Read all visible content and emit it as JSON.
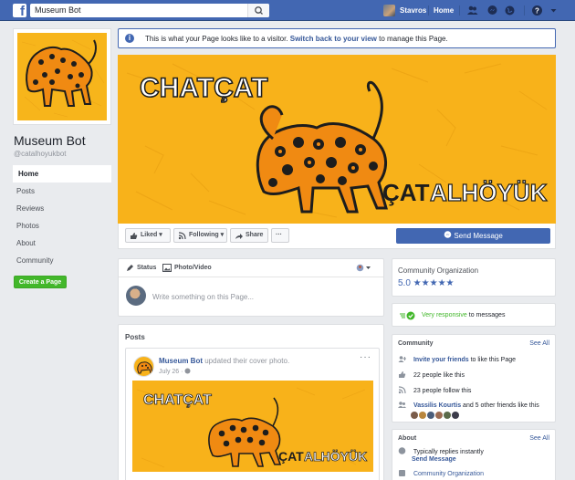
{
  "topbar": {
    "logo": "f",
    "search_value": "Museum Bot",
    "user_name": "Stavros",
    "home_label": "Home"
  },
  "page": {
    "name": "Museum Bot",
    "handle": "@catalhoyukbot"
  },
  "leftnav": {
    "items": [
      {
        "label": "Home"
      },
      {
        "label": "Posts"
      },
      {
        "label": "Reviews"
      },
      {
        "label": "Photos"
      },
      {
        "label": "About"
      },
      {
        "label": "Community"
      }
    ],
    "create_label": "Create a Page"
  },
  "banner": {
    "text_before": "This is what your Page looks like to a visitor.",
    "link": "Switch back to your view",
    "text_after": "to manage this Page."
  },
  "cover": {
    "title_left": "CHATÇAT",
    "title_right_a": "ÇAT",
    "title_right_b": "ALHÖYÜK",
    "accent_color": "#f8b21a"
  },
  "actions": {
    "liked": "Liked",
    "following": "Following",
    "share": "Share",
    "more": "···",
    "send_message": "Send Message"
  },
  "composer": {
    "status_tab": "Status",
    "photo_tab": "Photo/Video",
    "placeholder": "Write something on this Page..."
  },
  "posts": {
    "title": "Posts",
    "author": "Museum Bot",
    "action": "updated their cover photo.",
    "date": "July 26 ·",
    "more": "···"
  },
  "sidebar": {
    "category": "Community Organization",
    "rating": "5.0 ★★★★★",
    "responsive_highlight": "Very responsive",
    "responsive_rest": "to messages",
    "community": {
      "heading": "Community",
      "see_all": "See All",
      "invite_link": "Invite your friends",
      "invite_rest": "to like this Page",
      "likes": "22 people like this",
      "follows": "23 people follow this",
      "friend_name": "Vassilis Kourtis",
      "friend_rest": "and 5 other friends like this"
    },
    "about": {
      "heading": "About",
      "see_all": "See All",
      "replies": "Typically replies instantly",
      "send_message": "Send Message",
      "category_link": "Community Organization"
    }
  }
}
